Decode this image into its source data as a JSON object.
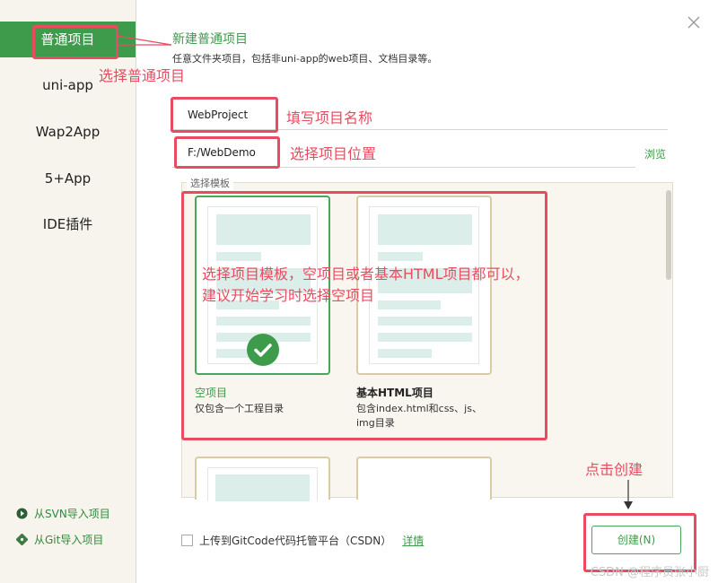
{
  "sidebar": {
    "items": [
      {
        "label": "普通项目"
      },
      {
        "label": "uni-app"
      },
      {
        "label": "Wap2App"
      },
      {
        "label": "5+App"
      },
      {
        "label": "IDE插件"
      }
    ],
    "svn_link": "从SVN导入项目",
    "git_link": "从Git导入项目"
  },
  "header": {
    "title": "新建普通项目",
    "description": "任意文件夹项目，包括非uni-app的web项目、文档目录等。"
  },
  "form": {
    "project_name": "WebProject",
    "project_path": "F:/WebDemo",
    "browse_label": "浏览"
  },
  "templates": {
    "legend": "选择模板",
    "items": [
      {
        "name": "空项目",
        "desc": "仅包含一个工程目录"
      },
      {
        "name": "基本HTML项目",
        "desc_line1": "包含index.html和css、js、",
        "desc_line2": "img目录"
      }
    ]
  },
  "footer": {
    "upload_label": "上传到GitCode代码托管平台（CSDN）",
    "detail_label": "详情",
    "create_label": "创建(N)"
  },
  "annotations": {
    "select_normal": "选择普通项目",
    "fill_name": "填写项目名称",
    "select_location": "选择项目位置",
    "select_template_line1": "选择项目模板，空项目或者基本HTML项目都可以，",
    "select_template_line2": "建议开始学习时选择空项目",
    "click_create": "点击创建"
  },
  "watermark": "CSDN @程序员张小厨",
  "colors": {
    "accent": "#3d9b4b",
    "annotation": "#e94b60",
    "sidebar_bg": "#f6f4ec",
    "template_bg": "#f8f6ee"
  }
}
